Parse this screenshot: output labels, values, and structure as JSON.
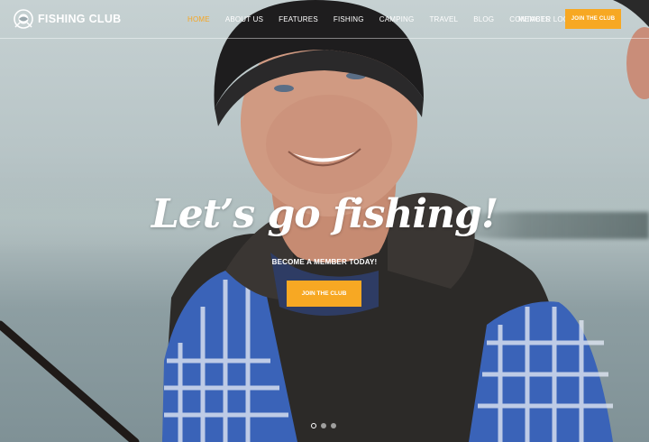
{
  "brand": {
    "name": "FISHING CLUB",
    "logo_icon": "fishing-club-logo-icon"
  },
  "nav": {
    "items": [
      {
        "label": "HOME",
        "active": true
      },
      {
        "label": "ABOUT US",
        "active": false
      },
      {
        "label": "FEATURES",
        "active": false
      },
      {
        "label": "FISHING",
        "active": false
      },
      {
        "label": "CAMPING",
        "active": false
      },
      {
        "label": "TRAVEL",
        "active": false
      },
      {
        "label": "BLOG",
        "active": false
      },
      {
        "label": "CONTACTS",
        "active": false
      }
    ],
    "member_login": "MEMBER LOGIN",
    "join_button": "JOIN THE CLUB"
  },
  "hero": {
    "headline": "Let’s go fishing!",
    "subheadline": "BECOME A MEMBER TODAY!",
    "cta": "JOIN THE CLUB",
    "slides": {
      "count": 3,
      "active": 1
    }
  },
  "colors": {
    "accent": "#f7a823",
    "active_nav": "#f5a623",
    "text": "#ffffff"
  }
}
